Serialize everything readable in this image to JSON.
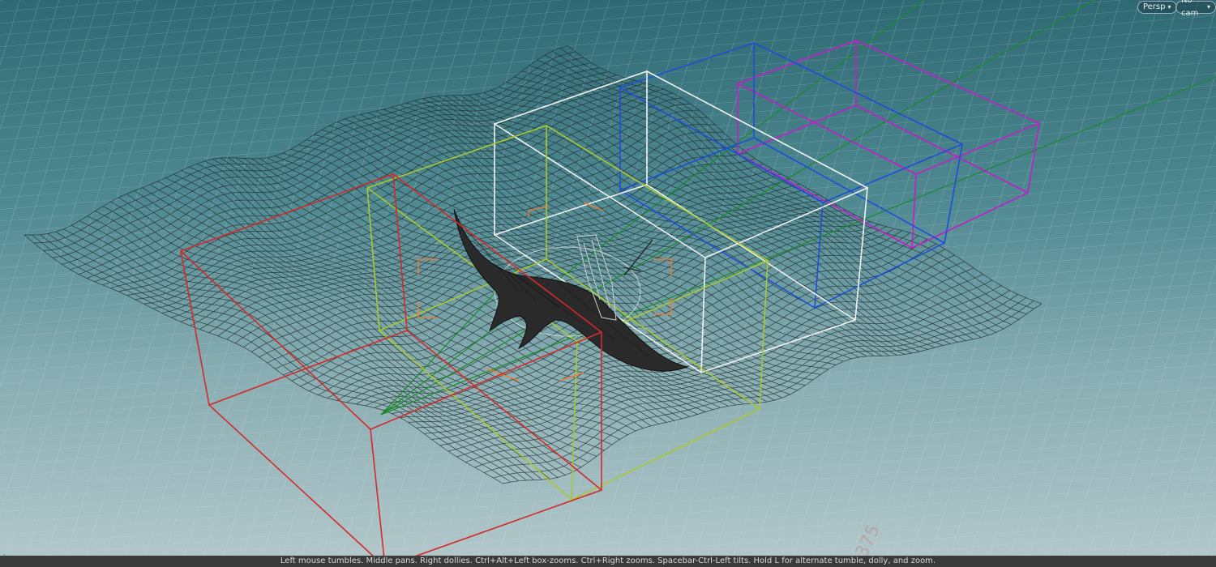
{
  "viewport": {
    "view_menu": {
      "label": "Persp",
      "icon": "dropdown-arrow"
    },
    "camera_menu": {
      "label": "No cam",
      "icon": "dropdown-arrow"
    },
    "status_hint": "Left mouse tumbles. Middle pans. Right dollies. Ctrl+Alt+Left box-zooms. Ctrl+Right zooms. Spacebar-Ctrl-Left tilts. Hold L for alternate tumble, dolly, and zoom.",
    "grid_ruler_label": "375",
    "colors": {
      "background_top": "#2f6a74",
      "background_bottom": "#b4c8cb",
      "terrain_wire": "#1e2a2c",
      "box_red": "#d42a2a",
      "box_yellow_green": "#a8c832",
      "box_white": "#f2f2f2",
      "box_blue": "#1d4fd6",
      "box_magenta": "#c21fc8",
      "guide_green": "#1a8a2a",
      "gizmo_orange": "#ff7a2a"
    }
  }
}
